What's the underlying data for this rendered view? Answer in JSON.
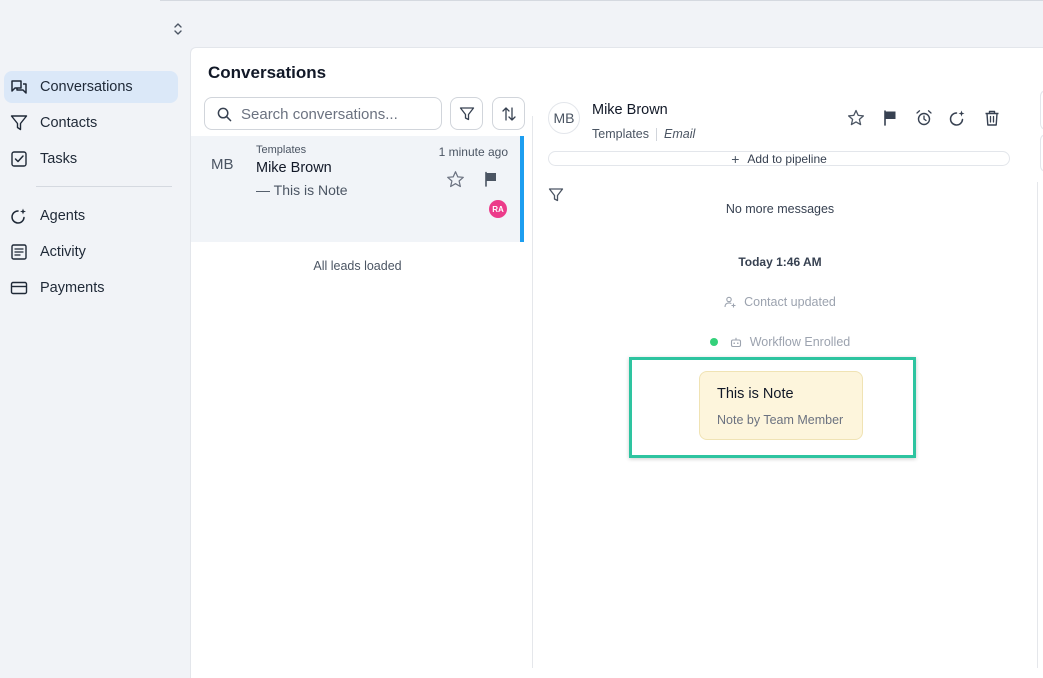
{
  "sidebar": {
    "items": [
      {
        "label": "Conversations",
        "icon": "conversations-icon",
        "active": true
      },
      {
        "label": "Contacts",
        "icon": "filter-icon"
      },
      {
        "label": "Tasks",
        "icon": "task-check-icon"
      },
      {
        "label": "Agents",
        "icon": "agents-sparkle-icon"
      },
      {
        "label": "Activity",
        "icon": "activity-doc-icon"
      },
      {
        "label": "Payments",
        "icon": "credit-card-icon"
      }
    ]
  },
  "main": {
    "title": "Conversations",
    "search": {
      "placeholder": "Search conversations...",
      "value": ""
    },
    "list": {
      "items": [
        {
          "avatar": "MB",
          "source": "Templates",
          "name": "Mike Brown",
          "preview": "— This is Note",
          "time": "1 minute ago",
          "badge": "RA",
          "badge_color": "#ec3b8a"
        }
      ],
      "footer": "All leads loaded"
    }
  },
  "thread": {
    "contact": {
      "avatar": "MB",
      "name": "Mike Brown",
      "source": "Templates",
      "channel": "Email"
    },
    "pipeline_label": "Add to pipeline",
    "no_more": "No more messages",
    "date_separator": "Today 1:46 AM",
    "events": [
      {
        "text": "Contact updated",
        "icon": "user-plus-icon"
      },
      {
        "text": "Workflow Enrolled",
        "icon": "bot-icon",
        "status_color": "#34d17a"
      }
    ],
    "note": {
      "title": "This is Note",
      "by": "Note by Team Member"
    },
    "highlight_color": "#2ec4a0"
  },
  "colors": {
    "accent": "#1d9ef0",
    "active_nav": "#dbe8f8"
  }
}
